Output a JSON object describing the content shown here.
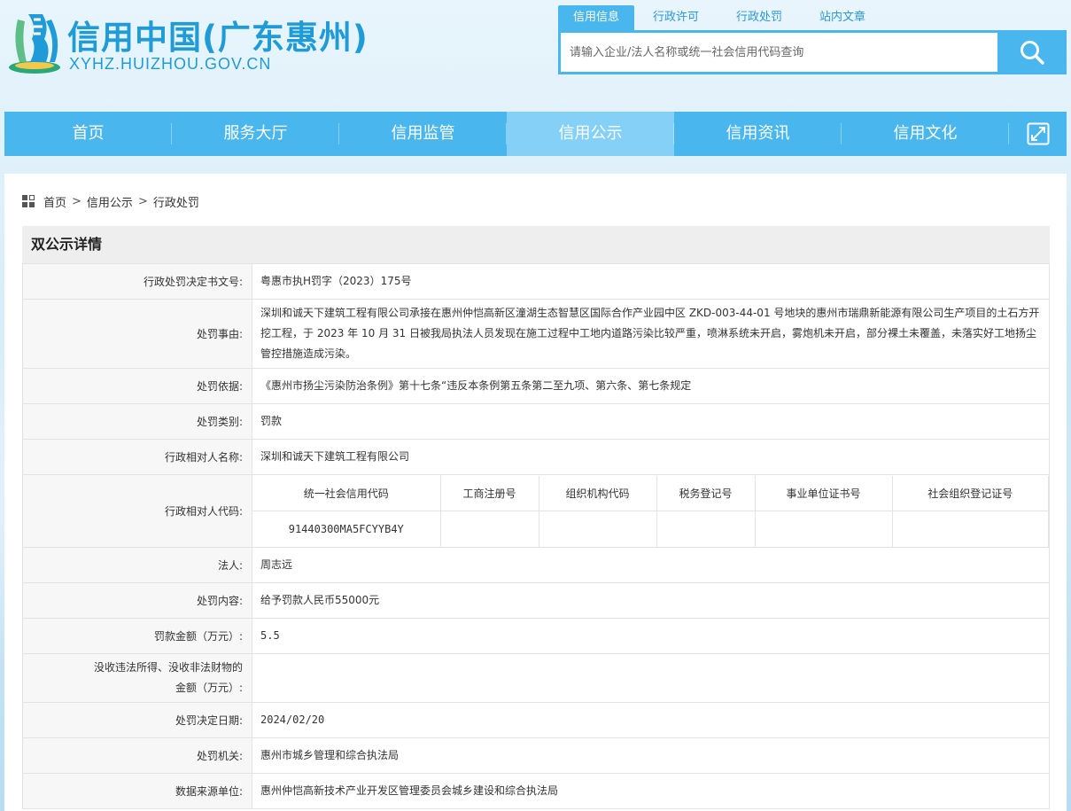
{
  "header": {
    "site_title": "信用中国(广东惠州)",
    "site_domain": "XYHZ.HUIZHOU.GOV.CN",
    "search_tabs": [
      "信用信息",
      "行政许可",
      "行政处罚",
      "站内文章"
    ],
    "search_placeholder": "请输入企业/法人名称或统一社会信用代码查询"
  },
  "nav": {
    "items": [
      "首页",
      "服务大厅",
      "信用监管",
      "信用公示",
      "信用资讯",
      "信用文化"
    ],
    "active_index": 3
  },
  "breadcrumb": [
    "首页",
    "信用公示",
    "行政处罚"
  ],
  "detail": {
    "title": "双公示详情",
    "rows": {
      "decision_no": {
        "label": "行政处罚决定书文号:",
        "value": "粤惠市执H罚字（2023）175号"
      },
      "reason": {
        "label": "处罚事由:",
        "value": "深圳和诚天下建筑工程有限公司承接在惠州仲恺高新区潼湖生态智慧区国际合作产业园中区 ZKD-003-44-01 号地块的惠州市瑞鼎新能源有限公司生产项目的土石方开挖工程，于 2023 年 10 月 31 日被我局执法人员发现在施工过程中工地内道路污染比较严重，喷淋系统未开启，雾炮机未开启，部分裸土未覆盖，未落实好工地扬尘管控措施造成污染。"
      },
      "basis": {
        "label": "处罚依据:",
        "value": "《惠州市扬尘污染防治条例》第十七条“违反本条例第五条第二至九项、第六条、第七条规定"
      },
      "category": {
        "label": "处罚类别:",
        "value": "罚款"
      },
      "party_name": {
        "label": "行政相对人名称:",
        "value": "深圳和诚天下建筑工程有限公司"
      },
      "party_code": {
        "label": "行政相对人代码:",
        "headers": [
          "统一社会信用代码",
          "工商注册号",
          "组织机构代码",
          "税务登记号",
          "事业单位证书号",
          "社会组织登记证号"
        ],
        "values": [
          "91440300MA5FCYYB4Y",
          "",
          "",
          "",
          "",
          ""
        ]
      },
      "legal_person": {
        "label": "法人:",
        "value": "周志远"
      },
      "content": {
        "label": "处罚内容:",
        "value": "给予罚款人民币55000元"
      },
      "amount": {
        "label": "罚款金额（万元）:",
        "value": "5.5"
      },
      "confiscated": {
        "label_line1": "没收违法所得、没收非法财物的",
        "label_line2": "金额（万元）:",
        "value": ""
      },
      "date": {
        "label": "处罚决定日期:",
        "value": "2024/02/20"
      },
      "authority": {
        "label": "处罚机关:",
        "value": "惠州市城乡管理和综合执法局"
      },
      "source": {
        "label": "数据来源单位:",
        "value": "惠州仲恺高新技术产业开发区管理委员会城乡建设和综合执法局"
      }
    }
  },
  "colors": {
    "brand_blue": "#1f9bd7",
    "nav_bg": "#4ab6ee",
    "nav_active": "#85d0f6"
  }
}
